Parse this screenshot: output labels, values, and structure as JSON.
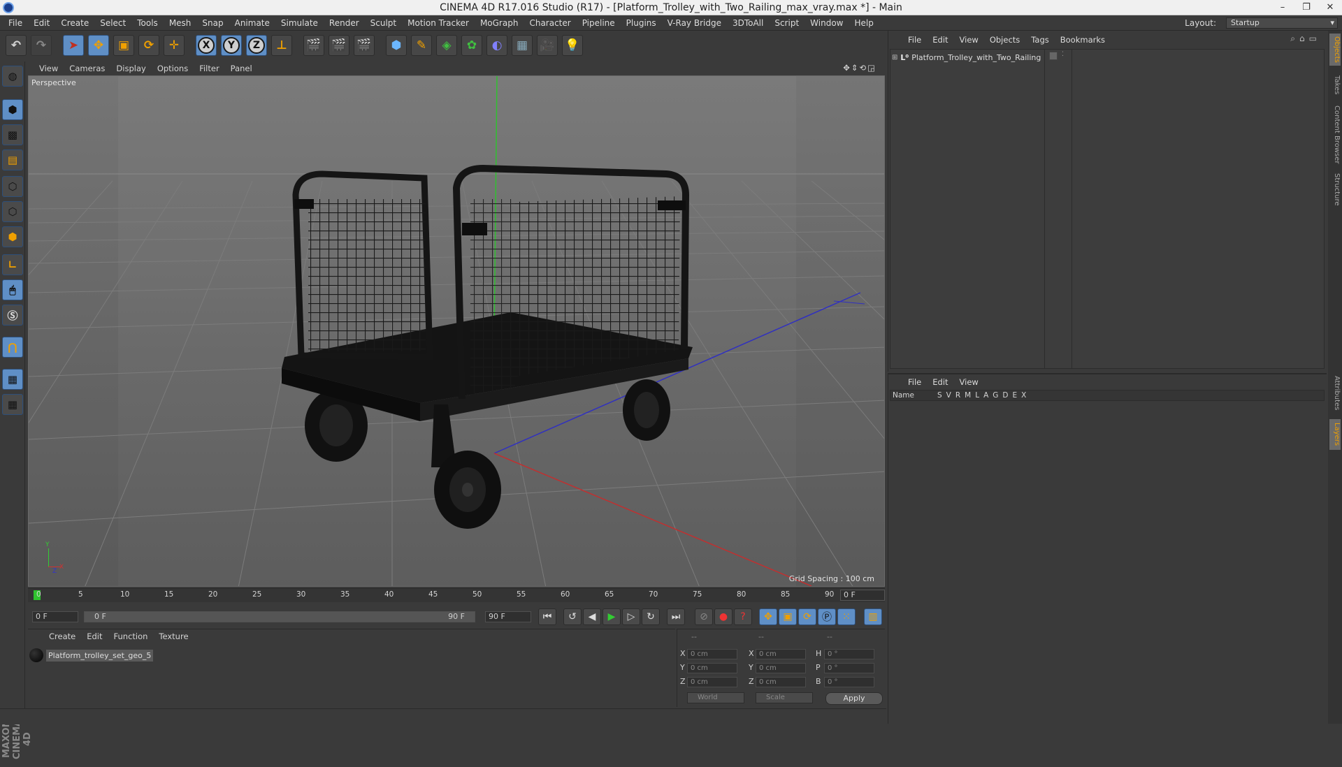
{
  "window": {
    "title": "CINEMA 4D R17.016 Studio (R17) - [Platform_Trolley_with_Two_Railing_max_vray.max *] - Main",
    "controls": [
      "–",
      "❐",
      "✕"
    ]
  },
  "menubar": {
    "items": [
      "File",
      "Edit",
      "Create",
      "Select",
      "Tools",
      "Mesh",
      "Snap",
      "Animate",
      "Simulate",
      "Render",
      "Sculpt",
      "Motion Tracker",
      "MoGraph",
      "Character",
      "Pipeline",
      "Plugins",
      "V-Ray Bridge",
      "3DToAll",
      "Script",
      "Window",
      "Help"
    ],
    "layout_label": "Layout:",
    "layout_value": "Startup"
  },
  "toolbar": {
    "axis_x": "X",
    "axis_y": "Y",
    "axis_z": "Z"
  },
  "viewport": {
    "menu": [
      "View",
      "Cameras",
      "Display",
      "Options",
      "Filter",
      "Panel"
    ],
    "nav_icons": "✥⇕⟲◲",
    "label": "Perspective",
    "grid_spacing": "Grid Spacing : 100 cm",
    "axis_y_label": "Y",
    "axis_x_label": "X",
    "axis_z_label": "Z"
  },
  "timeline": {
    "ticks": [
      "0",
      "5",
      "10",
      "15",
      "20",
      "25",
      "30",
      "35",
      "40",
      "45",
      "50",
      "55",
      "60",
      "65",
      "70",
      "75",
      "80",
      "85",
      "90"
    ],
    "frame": "0 F"
  },
  "transport": {
    "start": "0 F",
    "range_start": "0 F",
    "range_end": "90 F",
    "end": "90 F"
  },
  "material_manager": {
    "menu": [
      "Create",
      "Edit",
      "Function",
      "Texture"
    ],
    "material_name": "Platform_trolley_set_geo_5"
  },
  "coordinates": {
    "headers": [
      "--",
      "--",
      "--"
    ],
    "rows": [
      {
        "a": "X",
        "av": "0 cm",
        "b": "X",
        "bv": "0 cm",
        "c": "H",
        "cv": "0 °"
      },
      {
        "a": "Y",
        "av": "0 cm",
        "b": "Y",
        "bv": "0 cm",
        "c": "P",
        "cv": "0 °"
      },
      {
        "a": "Z",
        "av": "0 cm",
        "b": "Z",
        "bv": "0 cm",
        "c": "B",
        "cv": "0 °"
      }
    ],
    "mode": "World",
    "transform": "Scale",
    "apply": "Apply"
  },
  "object_manager": {
    "menu": [
      "File",
      "Edit",
      "View",
      "Objects",
      "Tags",
      "Bookmarks"
    ],
    "object_name": "Platform_Trolley_with_Two_Railing"
  },
  "layer_manager": {
    "menu": [
      "File",
      "Edit",
      "View"
    ],
    "columns": [
      "Name",
      "S",
      "V",
      "R",
      "M",
      "L",
      "A",
      "G",
      "D",
      "E",
      "X"
    ]
  },
  "side_tabs": [
    "Objects",
    "Takes",
    "Content Browser",
    "Structure",
    "Attributes",
    "Layers"
  ],
  "branding": "MAXON CINEMA 4D"
}
